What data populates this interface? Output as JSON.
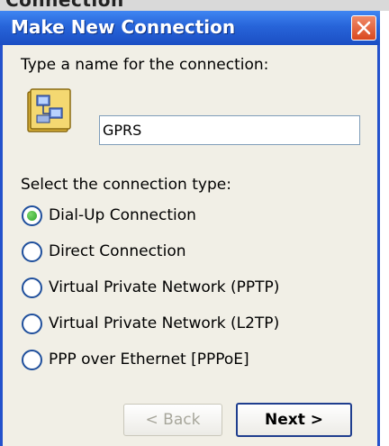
{
  "background_window": {
    "title_fragment": "Connection"
  },
  "dialog": {
    "title": "Make New Connection",
    "close_symbol": "×",
    "name_prompt": "Type a name for the connection:",
    "name_value": "GPRS",
    "type_prompt": "Select the connection type:",
    "connection_types": [
      {
        "label": "Dial-Up Connection",
        "selected": true
      },
      {
        "label": "Direct Connection",
        "selected": false
      },
      {
        "label": "Virtual Private Network (PPTP)",
        "selected": false
      },
      {
        "label": "Virtual Private Network (L2TP)",
        "selected": false
      },
      {
        "label": "PPP over Ethernet [PPPoE]",
        "selected": false
      }
    ],
    "buttons": {
      "back": "< Back",
      "next": "Next >"
    }
  },
  "icons": {
    "connection": "network-connection-icon",
    "close": "close-icon"
  },
  "colors": {
    "titlebar": "#2764d9",
    "window_bg": "#f1efe6",
    "radio_selected": "#2ea52a",
    "close_button": "#d9481f"
  }
}
